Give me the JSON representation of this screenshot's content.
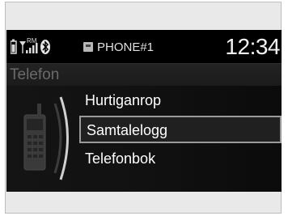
{
  "status": {
    "device_name": "PHONE#1",
    "time": "12:34",
    "roaming_label": "RM"
  },
  "title": "Telefon",
  "menu": {
    "items": [
      {
        "label": "Hurtiganrop"
      },
      {
        "label": "Samtalelogg"
      },
      {
        "label": "Telefonbok"
      }
    ],
    "selected_index": 1
  },
  "colors": {
    "screen_bg": "#0c0c0c",
    "selection_border": "#9a9a9a",
    "title_text": "#6a6a6a"
  }
}
